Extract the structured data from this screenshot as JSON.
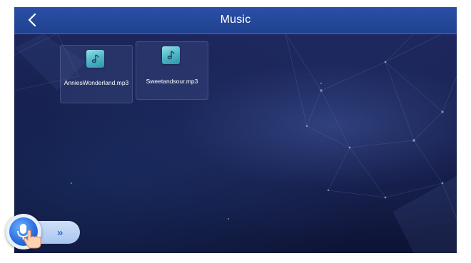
{
  "header": {
    "title": "Music",
    "back_icon": "chevron-left-icon"
  },
  "files": [
    {
      "icon": "music-note-icon",
      "name": "AnniesWonderland.mp3"
    },
    {
      "icon": "music-note-icon",
      "name": "Sweetandsour.mp3"
    }
  ],
  "voice_assistant": {
    "icon": "microphone-icon",
    "hand_icon": "hand-pointer-icon",
    "expand_icon": "double-chevron-right-icon"
  },
  "colors": {
    "topbar": "#20428f",
    "background": "#141b46",
    "file_icon": "#4fb8c7",
    "voice_button": "#2c6fe0"
  }
}
